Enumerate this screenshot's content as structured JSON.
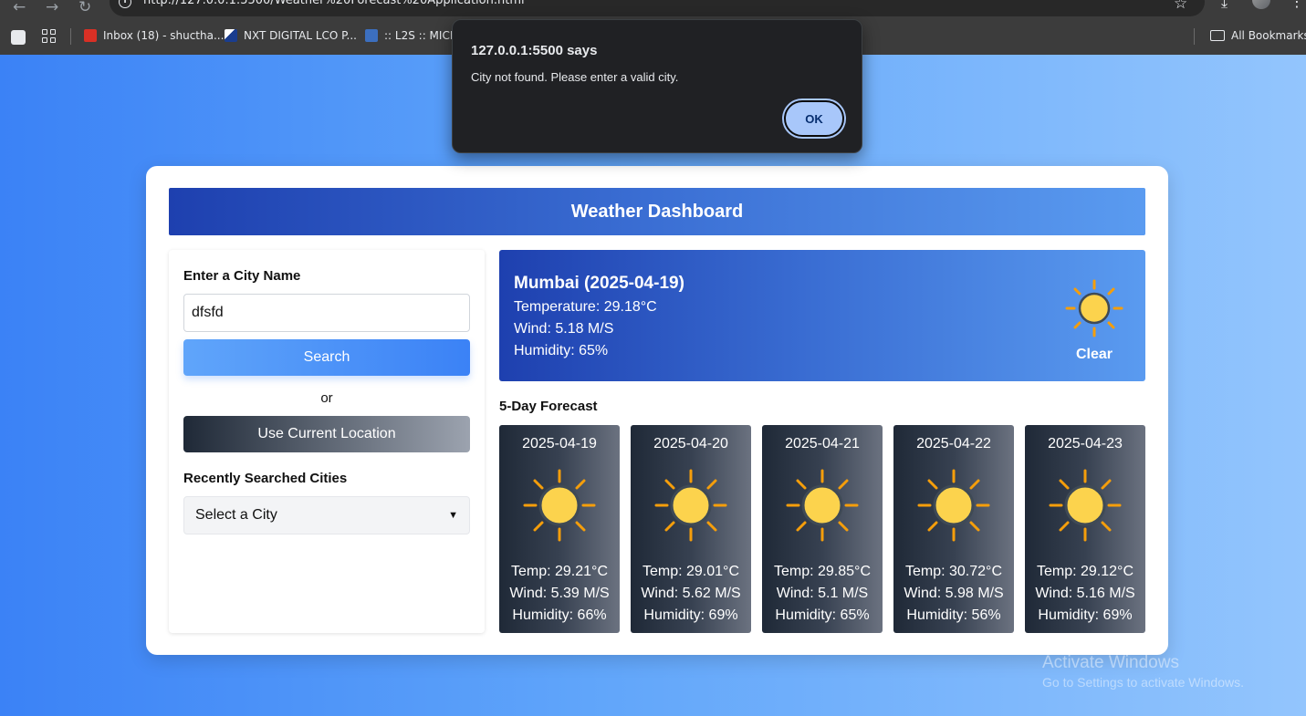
{
  "browser": {
    "url": "http://127.0.0.1:5500/Weather%20Forecast%20Application.html",
    "bookmarks": [
      {
        "label": "Inbox (18) - shuctha...",
        "icon": "gmail-icon",
        "color": "#d93025"
      },
      {
        "label": "NXT DIGITAL LCO P...",
        "icon": "nxt-digital-icon",
        "color": "#1a3d8f"
      },
      {
        "label": ":: L2S :: MICRO",
        "icon": "l2s-icon",
        "color": "#3c6fbf"
      }
    ],
    "all_bookmarks_label": "All Bookmarks"
  },
  "dialog": {
    "title": "127.0.0.1:5500 says",
    "message": "City not found. Please enter a valid city.",
    "ok_label": "OK"
  },
  "app": {
    "title": "Weather Dashboard",
    "search": {
      "label": "Enter a City Name",
      "value": "dfsfd",
      "button": "Search",
      "or_text": "or",
      "location_button": "Use Current Location"
    },
    "recent": {
      "label": "Recently Searched Cities",
      "selected": "Select a City"
    },
    "current": {
      "city_date": "Mumbai (2025-04-19)",
      "temperature": "Temperature: 29.18°C",
      "wind": "Wind: 5.18 M/S",
      "humidity": "Humidity: 65%",
      "description": "Clear",
      "icon": "sun-icon"
    },
    "forecast_title": "5-Day Forecast",
    "forecast": [
      {
        "date": "2025-04-19",
        "temp": "Temp: 29.21°C",
        "wind": "Wind: 5.39 M/S",
        "humidity": "Humidity: 66%",
        "icon": "sun-icon"
      },
      {
        "date": "2025-04-20",
        "temp": "Temp: 29.01°C",
        "wind": "Wind: 5.62 M/S",
        "humidity": "Humidity: 69%",
        "icon": "sun-icon"
      },
      {
        "date": "2025-04-21",
        "temp": "Temp: 29.85°C",
        "wind": "Wind: 5.1 M/S",
        "humidity": "Humidity: 65%",
        "icon": "sun-icon"
      },
      {
        "date": "2025-04-22",
        "temp": "Temp: 30.72°C",
        "wind": "Wind: 5.98 M/S",
        "humidity": "Humidity: 56%",
        "icon": "sun-icon"
      },
      {
        "date": "2025-04-23",
        "temp": "Temp: 29.12°C",
        "wind": "Wind: 5.16 M/S",
        "humidity": "Humidity: 69%",
        "icon": "sun-icon"
      }
    ]
  },
  "watermark": {
    "line1": "Activate Windows",
    "line2": "Go to Settings to activate Windows."
  },
  "colors": {
    "header_gradient_start": "#1e40af",
    "header_gradient_end": "#5a9bf0",
    "search_button": "#3b82f6",
    "forecast_card": "#1f2937",
    "sun": "#fcd34d",
    "sun_rays": "#f59e0b",
    "dialog_ok": "#a8c7fa"
  }
}
